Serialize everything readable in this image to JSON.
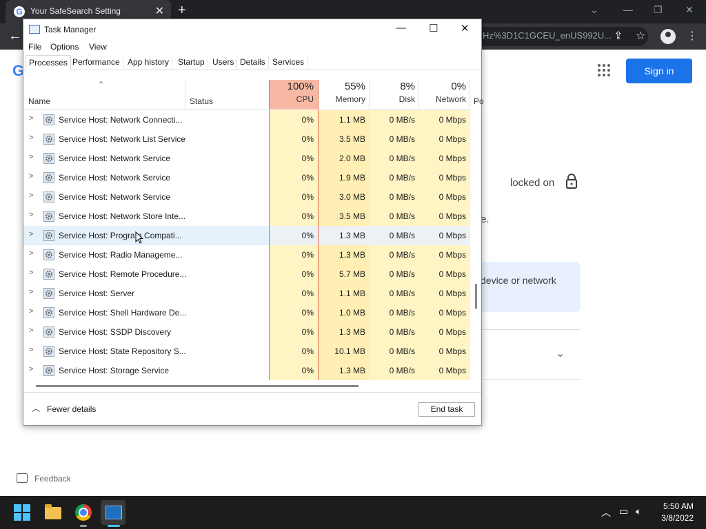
{
  "browser": {
    "tab_title": "Your SafeSearch Setting",
    "tab_close": "✕",
    "new_tab": "+",
    "url_fragment": "Hz%3D1C1GCEU_enUS992U...",
    "google_letter": "G",
    "sign_in": "Sign in",
    "locked_text": "locked on",
    "period_text": "e.",
    "info_text": "device or network",
    "feedback": "Feedback"
  },
  "task_manager": {
    "title": "Task Manager",
    "menu": [
      "File",
      "Options",
      "View"
    ],
    "tabs": [
      "Processes",
      "Performance",
      "App history",
      "Startup",
      "Users",
      "Details",
      "Services"
    ],
    "active_tab": "Processes",
    "columns": {
      "name": "Name",
      "status": "Status",
      "cpu": {
        "percent": "100%",
        "label": "CPU"
      },
      "memory": {
        "percent": "55%",
        "label": "Memory"
      },
      "disk": {
        "percent": "8%",
        "label": "Disk"
      },
      "network": {
        "percent": "0%",
        "label": "Network"
      },
      "power_partial": "Po"
    },
    "rows": [
      {
        "name": "Service Host: Network Connecti...",
        "cpu": "0%",
        "memory": "1.1 MB",
        "disk": "0 MB/s",
        "network": "0 Mbps"
      },
      {
        "name": "Service Host: Network List Service",
        "cpu": "0%",
        "memory": "3.5 MB",
        "disk": "0 MB/s",
        "network": "0 Mbps"
      },
      {
        "name": "Service Host: Network Service",
        "cpu": "0%",
        "memory": "2.0 MB",
        "disk": "0 MB/s",
        "network": "0 Mbps"
      },
      {
        "name": "Service Host: Network Service",
        "cpu": "0%",
        "memory": "1.9 MB",
        "disk": "0 MB/s",
        "network": "0 Mbps"
      },
      {
        "name": "Service Host: Network Service",
        "cpu": "0%",
        "memory": "3.0 MB",
        "disk": "0 MB/s",
        "network": "0 Mbps"
      },
      {
        "name": "Service Host: Network Store Inte...",
        "cpu": "0%",
        "memory": "3.5 MB",
        "disk": "0 MB/s",
        "network": "0 Mbps"
      },
      {
        "name": "Service Host: Program Compati...",
        "cpu": "0%",
        "memory": "1.3 MB",
        "disk": "0 MB/s",
        "network": "0 Mbps"
      },
      {
        "name": "Service Host: Radio Manageme...",
        "cpu": "0%",
        "memory": "1.3 MB",
        "disk": "0 MB/s",
        "network": "0 Mbps"
      },
      {
        "name": "Service Host: Remote Procedure...",
        "cpu": "0%",
        "memory": "5.7 MB",
        "disk": "0 MB/s",
        "network": "0 Mbps"
      },
      {
        "name": "Service Host: Server",
        "cpu": "0%",
        "memory": "1.1 MB",
        "disk": "0 MB/s",
        "network": "0 Mbps"
      },
      {
        "name": "Service Host: Shell Hardware De...",
        "cpu": "0%",
        "memory": "1.0 MB",
        "disk": "0 MB/s",
        "network": "0 Mbps"
      },
      {
        "name": "Service Host: SSDP Discovery",
        "cpu": "0%",
        "memory": "1.3 MB",
        "disk": "0 MB/s",
        "network": "0 Mbps"
      },
      {
        "name": "Service Host: State Repository S...",
        "cpu": "0%",
        "memory": "10.1 MB",
        "disk": "0 MB/s",
        "network": "0 Mbps"
      },
      {
        "name": "Service Host: Storage Service",
        "cpu": "0%",
        "memory": "1.3 MB",
        "disk": "0 MB/s",
        "network": "0 Mbps"
      }
    ],
    "hover_row_index": 6,
    "fewer_details": "Fewer details",
    "end_task": "End task"
  },
  "taskbar": {
    "time": "5:50 AM",
    "date": "3/8/2022"
  },
  "colors": {
    "cpu_header": "#f7b8a4",
    "cell_light": "#fff4c4",
    "cell_memory": "#ffefb4",
    "accent_blue": "#1a73e8"
  }
}
